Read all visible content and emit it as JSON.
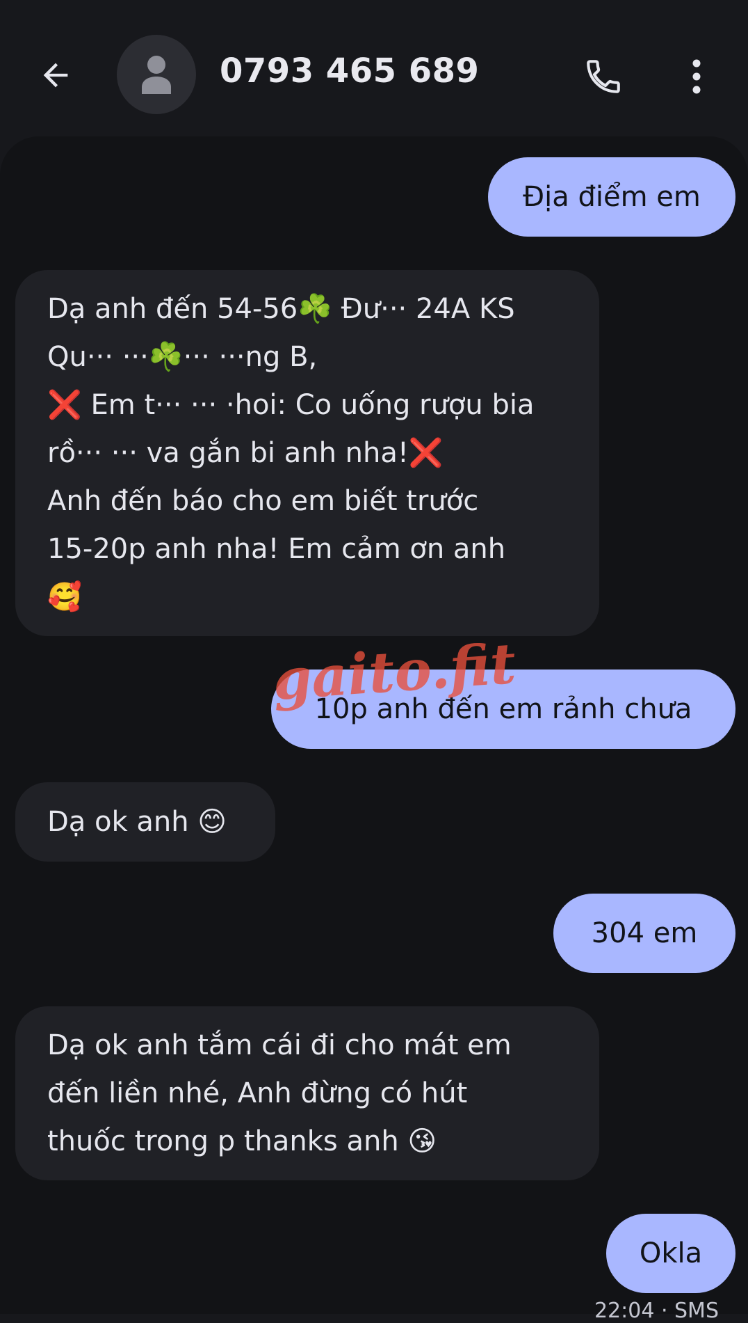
{
  "header": {
    "title": "0793 465 689",
    "back_icon": "arrow-left-icon",
    "avatar_icon": "person-icon",
    "call_icon": "phone-icon",
    "more_icon": "more-vert-icon"
  },
  "messages": [
    {
      "direction": "outgoing",
      "text": "Địa điểm em"
    },
    {
      "direction": "incoming",
      "text": "Dạ anh đến 54-56☘️ Đư··· 24A KS\nQu··· ···☘️··· ···ng B,\n❌ Em t··· ··· ·hoi: Co uống rượu bia\nrồ··· ··· va gắn bi anh nha!❌\nAnh đến báo cho em biết trước\n15-20p anh nha! Em cảm ơn anh\n🥰"
    },
    {
      "direction": "outgoing",
      "text": "10p anh đến em rảnh chưa"
    },
    {
      "direction": "incoming",
      "text": "Dạ ok anh 😊"
    },
    {
      "direction": "outgoing",
      "text": "304 em"
    },
    {
      "direction": "incoming",
      "text": "Dạ ok anh tắm cái đi cho mát em\nđến liền nhé, Anh đừng có hút\nthuốc trong p thanks anh 😘"
    },
    {
      "direction": "outgoing",
      "text": "Okla"
    }
  ],
  "last_message_meta": "22:04 · SMS",
  "watermark": "gaito.fit",
  "colors": {
    "background": "#17181c",
    "thread_background": "#121316",
    "outgoing_bubble": "#a9b7ff",
    "incoming_bubble": "#202126",
    "watermark": "#e8503c"
  }
}
